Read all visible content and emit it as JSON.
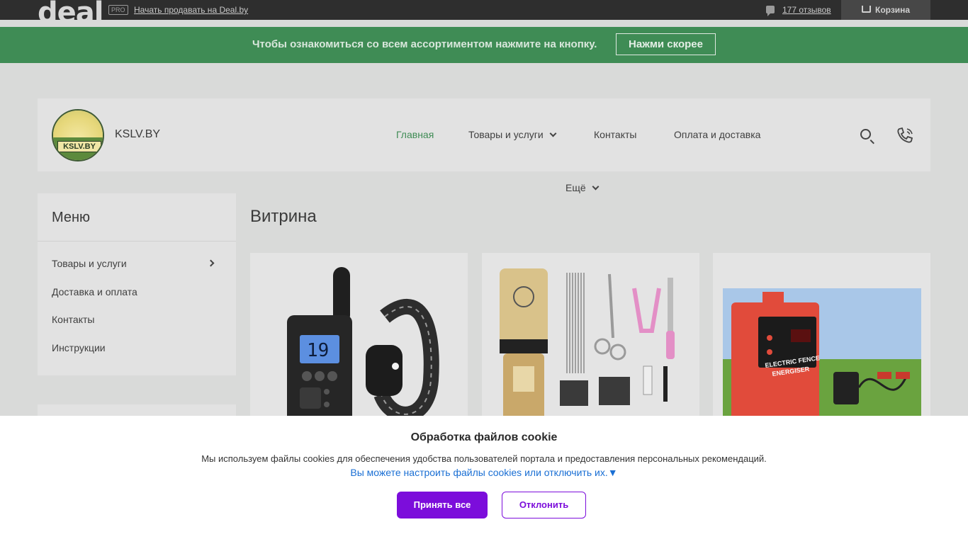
{
  "topbar": {
    "logo_text": "deal",
    "pro_badge": "PRO",
    "sell_link": "Начать продавать на Deal.by",
    "reviews_link": "177 отзывов",
    "cart_label": "Корзина"
  },
  "banner": {
    "text": "Чтобы ознакомиться со всем ассортиментом нажмите на кнопку.",
    "button_label": "Нажми скорее"
  },
  "header": {
    "logo_text": "KSLV.BY",
    "site_name": "KSLV.BY",
    "nav": [
      {
        "label": "Главная",
        "active": true
      },
      {
        "label": "Товары и услуги",
        "dropdown": true
      },
      {
        "label": "Контакты"
      },
      {
        "label": "Оплата и доставка"
      }
    ],
    "more_label": "Ещё"
  },
  "sidebar": {
    "title": "Меню",
    "items": [
      {
        "label": "Товары и услуги",
        "has_submenu": true
      },
      {
        "label": "Доставка и оплата"
      },
      {
        "label": "Контакты"
      },
      {
        "label": "Инструкции"
      }
    ]
  },
  "main": {
    "title": "Витрина",
    "products": [
      {
        "image": "dog-training-collar-remote"
      },
      {
        "image": "pet-grooming-clipper-kit"
      },
      {
        "image": "electric-fence-energiser",
        "image_text": [
          "ELECTRIC FENCE",
          "ENERGISER"
        ]
      }
    ]
  },
  "cookie": {
    "title": "Обработка файлов cookie",
    "text": "Мы используем файлы cookies для обеспечения удобства пользователей портала и предоставления персональных рекомендаций.",
    "link": "Вы можете настроить файлы cookies или отключить их.▼",
    "accept_label": "Принять все",
    "decline_label": "Отклонить"
  },
  "colors": {
    "accent_green": "#3f8c55",
    "cookie_purple": "#7c0ddb",
    "link_blue": "#1a6fd4"
  }
}
